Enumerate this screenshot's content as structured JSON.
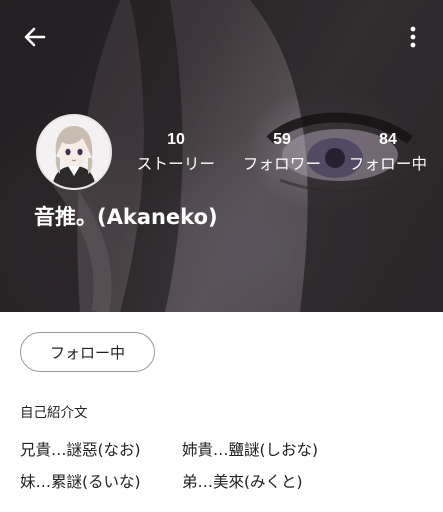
{
  "header": {
    "back_icon": "arrow-left-icon",
    "menu_icon": "more-vertical-icon"
  },
  "profile": {
    "name": "音推。(Akaneko)",
    "avatar": "character-avatar",
    "stats": [
      {
        "value": "10",
        "label": "ストーリー"
      },
      {
        "value": "59",
        "label": "フォロワー"
      },
      {
        "value": "84",
        "label": "フォロー中"
      }
    ]
  },
  "actions": {
    "follow_label": "フォロー中"
  },
  "bio": {
    "heading": "自己紹介文",
    "lines": [
      "兄貴…謎惡(なお)",
      "姉貴…鹽謎(しおな)",
      "妹…累謎(るいな)",
      "弟…美來(みくと)"
    ]
  },
  "colors": {
    "header_text": "#ffffff",
    "body_text": "#222222",
    "button_border": "#9a9a9a",
    "background": "#ffffff"
  }
}
